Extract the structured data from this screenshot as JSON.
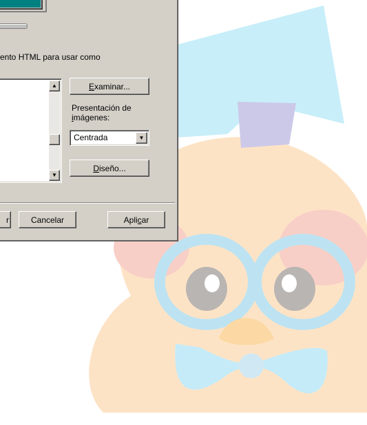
{
  "dialog": {
    "html_document_label": "ento HTML para usar como",
    "browse_button": {
      "label_pre": "",
      "label_underline": "E",
      "label_post": "xaminar..."
    },
    "image_display_label_line1": "Presentación de",
    "image_display_label_line2_underline": "i",
    "image_display_label_line2_rest": "mágenes:",
    "image_display_select": {
      "value": "Centrada"
    },
    "design_button": {
      "label_underline": "D",
      "label_post": "iseño..."
    },
    "ok_button": {
      "label": "r"
    },
    "cancel_button": {
      "label": "Cancelar"
    },
    "apply_button": {
      "label_pre": "Apli",
      "label_underline": "c",
      "label_post": "ar"
    }
  },
  "icons": {
    "scroll_up": "▲",
    "scroll_down": "▼",
    "combo_dropdown": "▼"
  },
  "colors": {
    "dialog_face": "#d4d0c8",
    "monitor_screen": "#008080",
    "wallpaper_bow_blue": "#c5ecf8",
    "wallpaper_body_orange": "#fde0c0",
    "wallpaper_cheek_red": "#f6c8c0"
  }
}
